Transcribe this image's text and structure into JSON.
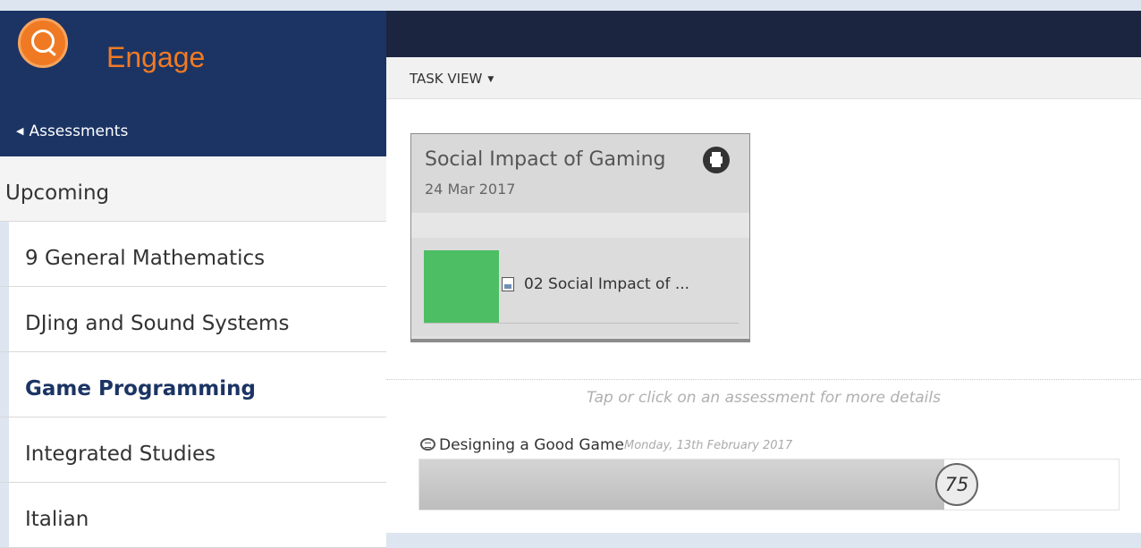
{
  "brand": {
    "name": "Engage",
    "logo_icon": "q-logo-icon",
    "accent": "#f07a24",
    "header_bg": "#1b3464"
  },
  "nav": {
    "back_label": "Assessments",
    "header": "Upcoming",
    "items": [
      {
        "label": "9 General Mathematics",
        "active": false
      },
      {
        "label": "DJing and Sound Systems",
        "active": false
      },
      {
        "label": "Game Programming",
        "active": true
      },
      {
        "label": "Integrated Studies",
        "active": false
      },
      {
        "label": "Italian",
        "active": false
      }
    ]
  },
  "toolbar": {
    "view_label": "TASK VIEW"
  },
  "card": {
    "title": "Social Impact of Gaming",
    "date": "24 Mar 2017",
    "item_label": "02 Social Impact of ...",
    "status_color": "#4dbe63",
    "print_icon": "printer-icon"
  },
  "hint": "Tap or click on an assessment for more details",
  "assessment": {
    "title": "Designing a Good Game",
    "date": "Monday, 13th February 2017",
    "score": "75",
    "progress_fraction": 0.75
  }
}
